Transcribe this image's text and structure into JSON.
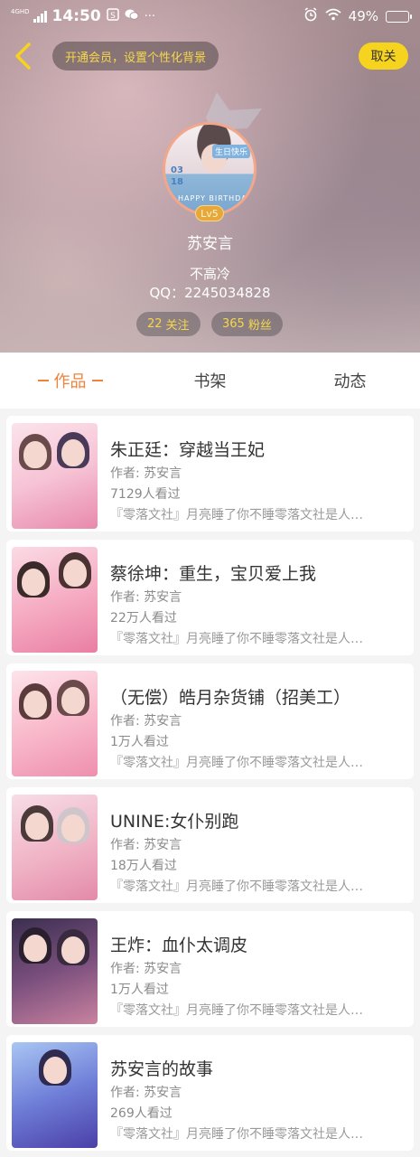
{
  "status_bar": {
    "network": "4GHD",
    "time": "14:50",
    "icons": [
      "signal-icon",
      "s-app-icon",
      "wechat-icon",
      "more-notifications-icon"
    ],
    "more": "···",
    "right_icons": [
      "alarm-icon",
      "wifi-icon"
    ],
    "battery_percent": "49%",
    "battery_level": 0.49
  },
  "header": {
    "vip_banner": "开通会员，设置个性化背景",
    "follow_label": "取关",
    "avatar_text": {
      "tag_top": "生日快乐",
      "date": "03\n18",
      "bottom": "HAPPY BIRTHDAY"
    },
    "level": "Lv5",
    "username": "苏安言",
    "bio": "不高冷",
    "qq": "QQ：2245034828",
    "following": {
      "count": "22",
      "label": "关注"
    },
    "fans": {
      "count": "365",
      "label": "粉丝"
    }
  },
  "tabs": [
    {
      "label": "作品",
      "active": true
    },
    {
      "label": "书架",
      "active": false
    },
    {
      "label": "动态",
      "active": false
    }
  ],
  "books": [
    {
      "title": "朱正廷：穿越当王妃",
      "author": "作者: 苏安言",
      "views": "7129人看过",
      "desc": "『零落文社』月亮睡了你不睡零落文社是人…"
    },
    {
      "title": "蔡徐坤：重生，宝贝爱上我",
      "author": "作者: 苏安言",
      "views": "22万人看过",
      "desc": "『零落文社』月亮睡了你不睡零落文社是人…"
    },
    {
      "title": "（无偿）皓月杂货铺（招美工）",
      "author": "作者: 苏安言",
      "views": "1万人看过",
      "desc": "『零落文社』月亮睡了你不睡零落文社是人…"
    },
    {
      "title": "UNINE:女仆别跑",
      "author": "作者: 苏安言",
      "views": "18万人看过",
      "desc": "『零落文社』月亮睡了你不睡零落文社是人…"
    },
    {
      "title": "王炸：血仆太调皮",
      "author": "作者: 苏安言",
      "views": "1万人看过",
      "desc": "『零落文社』月亮睡了你不睡零落文社是人…"
    },
    {
      "title": "苏安言的故事",
      "author": "作者: 苏安言",
      "views": "269人看过",
      "desc": "『零落文社』月亮睡了你不睡零落文社是人…"
    }
  ],
  "colors": {
    "accent": "#f0823a",
    "vip_text": "#f5d84a",
    "follow_button": "#f6d31e",
    "level_badge": "#e7a73a"
  }
}
